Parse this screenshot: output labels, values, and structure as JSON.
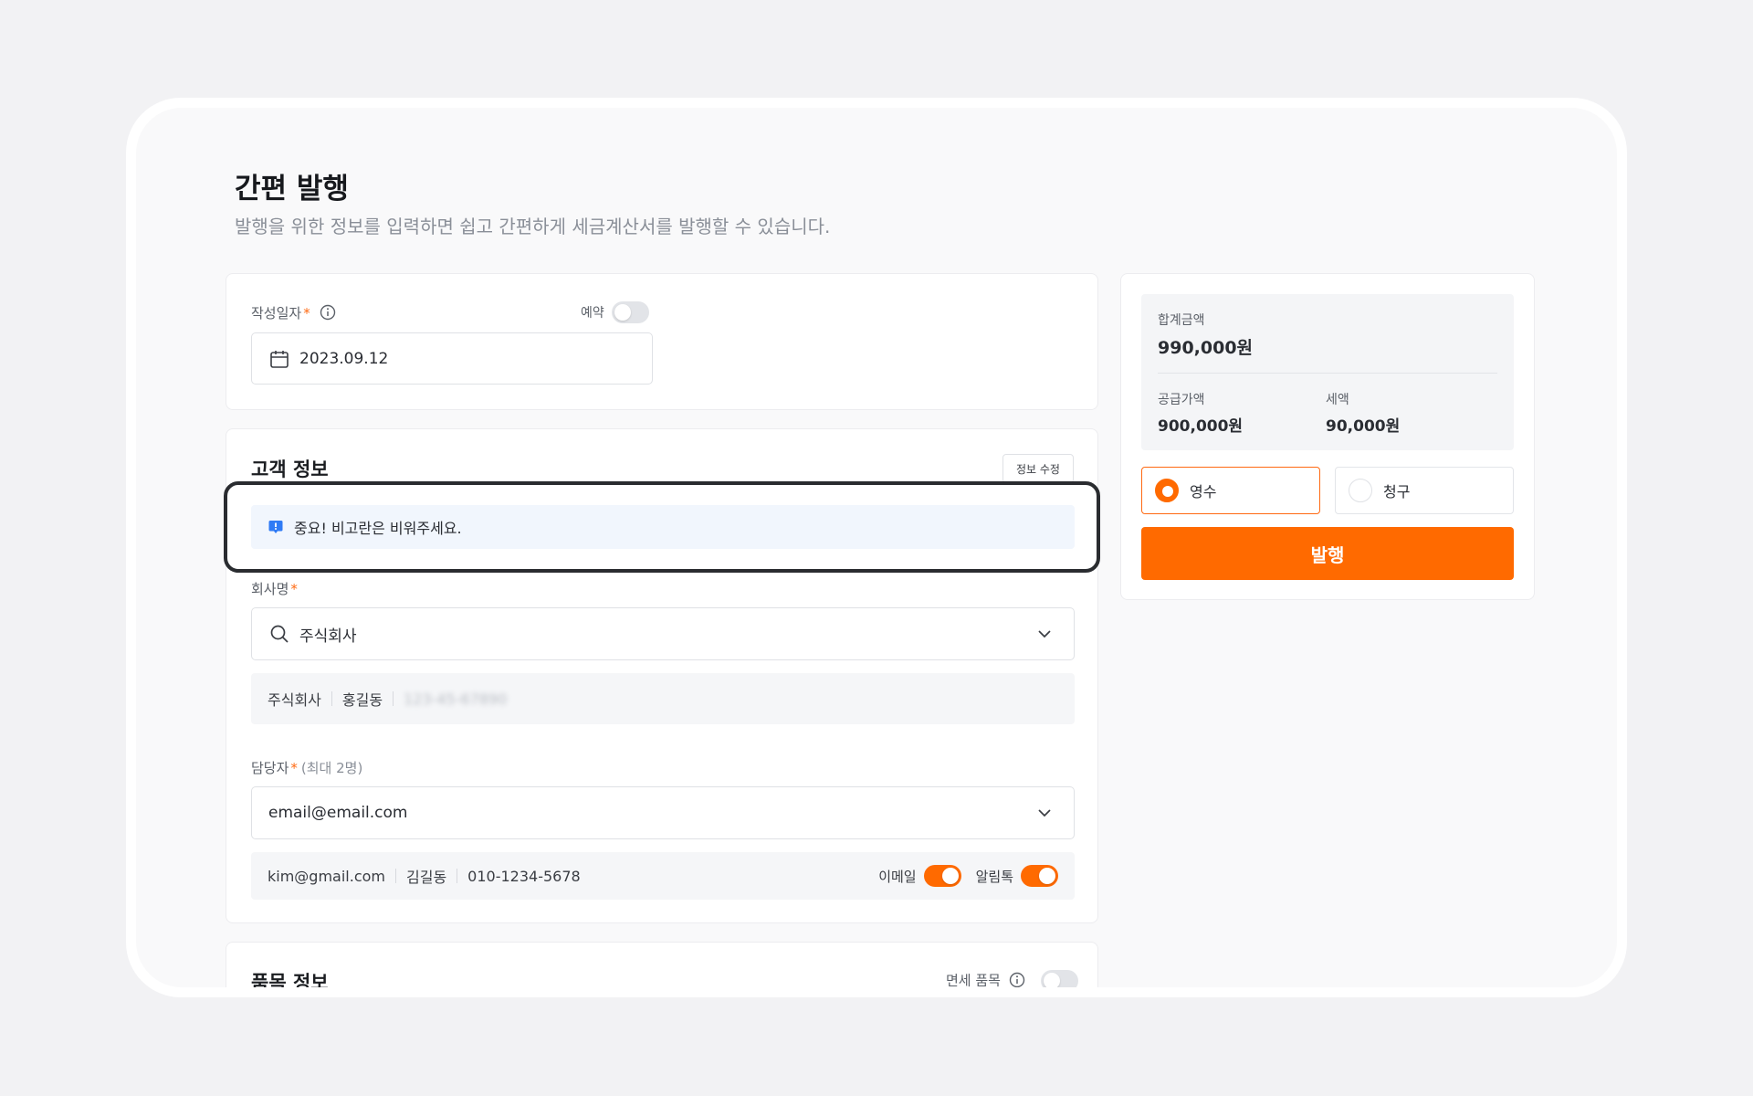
{
  "page": {
    "title": "간편 발행",
    "description": "발행을 위한 정보를 입력하면 쉽고 간편하게 세금계산서를 발행할 수 있습니다."
  },
  "date_card": {
    "label": "작성일자",
    "required_mark": "*",
    "info_icon": "info-circle-icon",
    "reserve_label": "예약",
    "reserve_enabled": false,
    "date_value": "2023.09.12",
    "date_icon": "calendar-icon"
  },
  "customer": {
    "title": "고객 정보",
    "edit_button": "정보 수정",
    "notice_text": "중요! 비고란은 비워주세요.",
    "notice_icon": "alert-badge-icon",
    "company_label": "회사명",
    "required_mark": "*",
    "company_value": "주식회사",
    "company_detail": {
      "name": "주식회사",
      "representative": "홍길동",
      "masked": "123-45-67890"
    },
    "manager_label": "담당자",
    "manager_note": "(최대 2명)",
    "manager_value": "email@email.com",
    "manager_detail": {
      "email": "kim@gmail.com",
      "name": "김길동",
      "phone": "010-1234-5678",
      "email_toggle_label": "이메일",
      "email_toggle_on": true,
      "alimtalk_toggle_label": "알림톡",
      "alimtalk_toggle_on": true
    }
  },
  "items": {
    "title": "품목 정보",
    "tax_free_label": "면세 품목",
    "tax_free_enabled": false
  },
  "summary": {
    "total_label": "합계금액",
    "total_value": "990,000원",
    "supply_label": "공급가액",
    "supply_value": "900,000원",
    "tax_label": "세액",
    "tax_value": "90,000원",
    "options": [
      "영수",
      "청구"
    ],
    "selected_option": "영수",
    "submit_label": "발행"
  },
  "colors": {
    "accent": "#ff6a00",
    "notice_bg": "#f1f6fd",
    "notice_icon": "#2f7bf5"
  }
}
